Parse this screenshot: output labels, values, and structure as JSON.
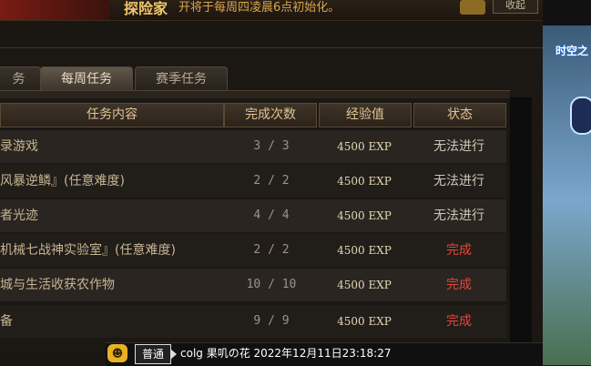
{
  "topbar": {
    "title": "探险家",
    "notice": "开将于每周四凌晨6点初始化。",
    "btn": "收起"
  },
  "tabs": [
    {
      "label": "务"
    },
    {
      "label": "每周任务"
    },
    {
      "label": "赛季任务"
    }
  ],
  "headers": {
    "name": "任务内容",
    "count": "完成次数",
    "exp": "经验值",
    "status": "状态"
  },
  "rows": [
    {
      "name": "录游戏",
      "count": "3 / 3",
      "exp": "4500 EXP",
      "status": "无法进行"
    },
    {
      "name": "风暴逆鳞』(任意难度)",
      "count": "2 / 2",
      "exp": "4500 EXP",
      "status": "无法进行"
    },
    {
      "name": "者光迹",
      "count": "4 / 4",
      "exp": "4500 EXP",
      "status": "无法进行"
    },
    {
      "name": "机械七战神实验室』(任意难度)",
      "count": "2 / 2",
      "exp": "4500 EXP",
      "status": "完成"
    },
    {
      "name": "城与生活收获农作物",
      "count": "10 / 10",
      "exp": "4500 EXP",
      "status": "完成"
    },
    {
      "name": "备",
      "count": "9 / 9",
      "exp": "4500 EXP",
      "status": "完成"
    }
  ],
  "side": {
    "label": "时空之"
  },
  "chat": {
    "icon": "☻",
    "channel": "普通",
    "message": "colg 果叽の花 2022年12月11日23:18:27"
  },
  "colors": {
    "done": "#e2473b",
    "header_text": "#e1c493",
    "accent": "#f2c66a"
  }
}
